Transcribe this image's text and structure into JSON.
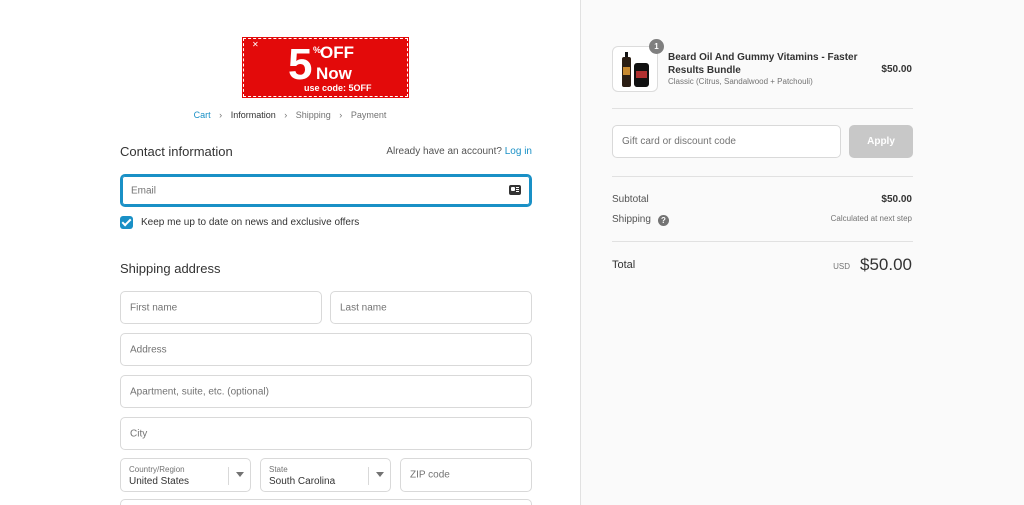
{
  "banner": {
    "number": "5",
    "pct": "%",
    "off": "OFF",
    "now": "Now",
    "code": "use code: 5OFF"
  },
  "breadcrumb": {
    "cart": "Cart",
    "information": "Information",
    "shipping": "Shipping",
    "payment": "Payment"
  },
  "contact": {
    "title": "Contact information",
    "account_prompt": "Already have an account?",
    "login_link": "Log in",
    "email_placeholder": "Email",
    "newsletter_label": "Keep me up to date on news and exclusive offers",
    "newsletter_checked": true
  },
  "shipping_address": {
    "title": "Shipping address",
    "first_name_placeholder": "First name",
    "last_name_placeholder": "Last name",
    "address_placeholder": "Address",
    "apartment_placeholder": "Apartment, suite, etc. (optional)",
    "city_placeholder": "City",
    "country_label": "Country/Region",
    "country_value": "United States",
    "state_label": "State",
    "state_value": "South Carolina",
    "zip_placeholder": "ZIP code"
  },
  "order_summary": {
    "product": {
      "quantity": "1",
      "name": "Beard Oil And Gummy Vitamins - Faster Results Bundle",
      "variant": "Classic (Citrus, Sandalwood + Patchouli)",
      "price": "$50.00"
    },
    "discount_placeholder": "Gift card or discount code",
    "apply_label": "Apply",
    "subtotal_label": "Subtotal",
    "subtotal_value": "$50.00",
    "shipping_label": "Shipping",
    "shipping_help_icon": "?",
    "shipping_value": "Calculated at next step",
    "total_label": "Total",
    "currency": "USD",
    "total_value": "$50.00"
  },
  "colors": {
    "accent": "#1990c6",
    "banner_red": "#e30a0a",
    "apply_disabled": "#c8c8c8"
  }
}
